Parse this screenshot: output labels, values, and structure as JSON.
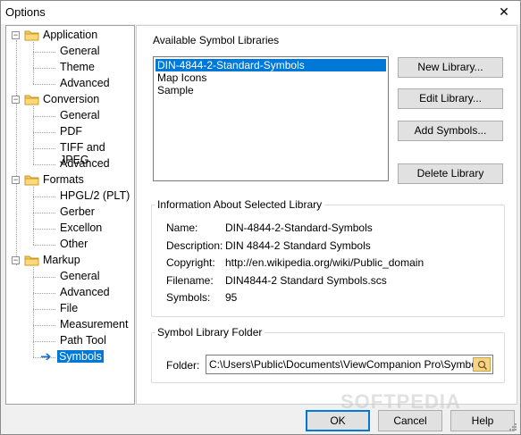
{
  "window": {
    "title": "Options"
  },
  "tree": {
    "groups": [
      {
        "label": "Application",
        "children": [
          "General",
          "Theme",
          "Advanced"
        ]
      },
      {
        "label": "Conversion",
        "children": [
          "General",
          "PDF",
          "TIFF and JPEG",
          "Advanced"
        ]
      },
      {
        "label": "Formats",
        "children": [
          "HPGL/2 (PLT)",
          "Gerber",
          "Excellon",
          "Other"
        ]
      },
      {
        "label": "Markup",
        "children": [
          "General",
          "Advanced",
          "File",
          "Measurement",
          "Path Tool",
          "Symbols"
        ]
      }
    ],
    "selected": "Symbols"
  },
  "libraries": {
    "heading": "Available Symbol Libraries",
    "items": [
      "DIN-4844-2-Standard-Symbols",
      "Map Icons",
      "Sample"
    ],
    "selected_index": 0
  },
  "buttons": {
    "new_library": "New Library...",
    "edit_library": "Edit Library...",
    "add_symbols": "Add Symbols...",
    "delete_library": "Delete Library"
  },
  "info": {
    "heading": "Information About Selected Library",
    "rows": [
      {
        "key": "Name:",
        "value": "DIN-4844-2-Standard-Symbols"
      },
      {
        "key": "Description:",
        "value": "DIN 4844-2 Standard Symbols"
      },
      {
        "key": "Copyright:",
        "value": "http://en.wikipedia.org/wiki/Public_domain"
      },
      {
        "key": "Filename:",
        "value": "DIN4844-2 Standard Symbols.scs"
      },
      {
        "key": "Symbols:",
        "value": "95"
      }
    ]
  },
  "folder": {
    "heading": "Symbol Library Folder",
    "label": "Folder:",
    "value": "C:\\Users\\Public\\Documents\\ViewCompanion Pro\\Symbols"
  },
  "footer": {
    "ok": "OK",
    "cancel": "Cancel",
    "help": "Help"
  },
  "watermark": "SOFTPEDIA"
}
